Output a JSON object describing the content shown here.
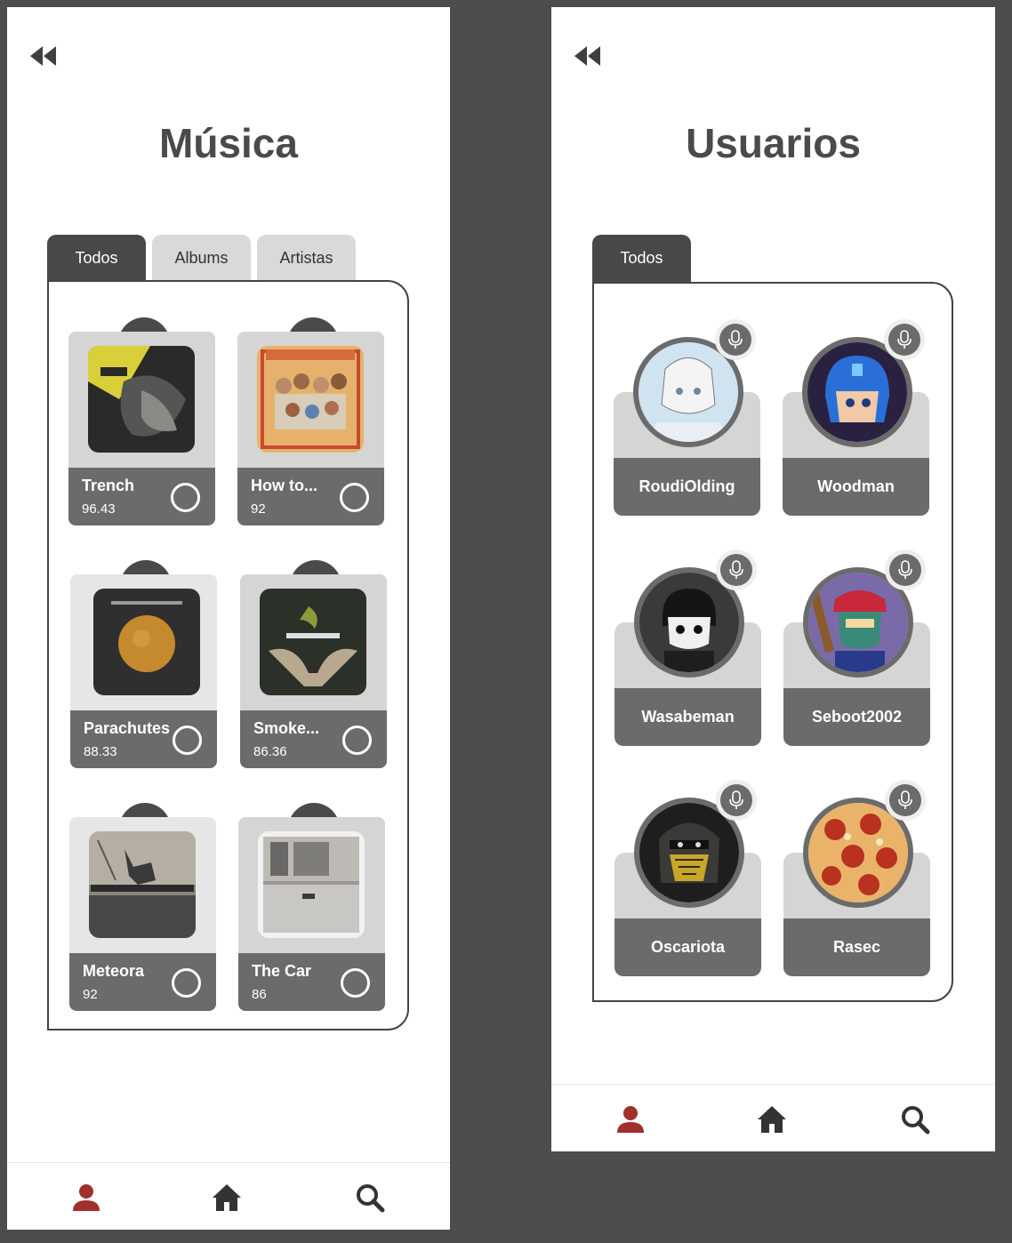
{
  "colors": {
    "accent": "#a0302c",
    "dark": "#484848",
    "card_dark": "#6b6b6b",
    "card_light": "#d5d5d5"
  },
  "music": {
    "title": "Música",
    "back_icon": "rewind-icon",
    "tabs": [
      {
        "label": "Todos",
        "active": true
      },
      {
        "label": "Albums",
        "active": false
      },
      {
        "label": "Artistas",
        "active": false
      }
    ],
    "albums": [
      {
        "name": "Trench",
        "score": "96.43"
      },
      {
        "name": "How to...",
        "score": "92"
      },
      {
        "name": "Parachutes",
        "score": "88.33"
      },
      {
        "name": "Smoke...",
        "score": "86.36"
      },
      {
        "name": "Meteora",
        "score": "92"
      },
      {
        "name": "The Car",
        "score": "86"
      }
    ],
    "nav": {
      "profile_icon": "user-icon",
      "home_icon": "home-icon",
      "search_icon": "search-icon"
    }
  },
  "users": {
    "title": "Usuarios",
    "back_icon": "rewind-icon",
    "tabs": [
      {
        "label": "Todos",
        "active": true
      }
    ],
    "list": [
      {
        "name": "RoudiOlding"
      },
      {
        "name": "Woodman"
      },
      {
        "name": "Wasabeman"
      },
      {
        "name": "Seboot2002"
      },
      {
        "name": "Oscariota"
      },
      {
        "name": "Rasec"
      }
    ],
    "nav": {
      "profile_icon": "user-icon",
      "home_icon": "home-icon",
      "search_icon": "search-icon"
    }
  }
}
